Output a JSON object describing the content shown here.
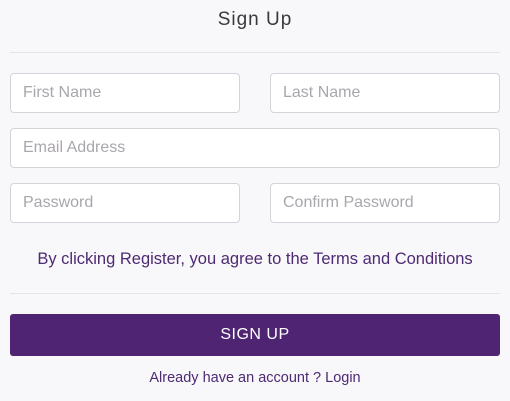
{
  "form": {
    "title": "Sign Up",
    "first_name_placeholder": "First Name",
    "last_name_placeholder": "Last Name",
    "email_placeholder": "Email Address",
    "password_placeholder": "Password",
    "confirm_password_placeholder": "Confirm Password",
    "terms_text": "By clicking Register, you agree to the Terms and Conditions",
    "submit_label": "SIGN UP",
    "login_prompt": "Already have an account ?",
    "login_link": "Login"
  },
  "colors": {
    "accent": "#4f2472",
    "text_purple": "#4d2a73",
    "background": "#f8f7f9"
  }
}
